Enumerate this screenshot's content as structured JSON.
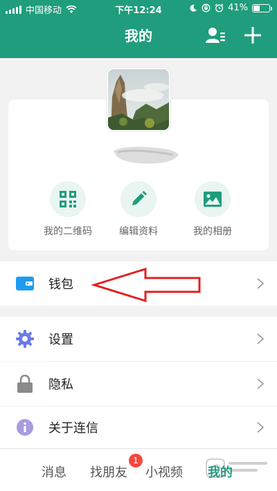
{
  "status_bar": {
    "carrier": "中国移动",
    "time": "下午12:24",
    "battery": "41%",
    "battery_level": 0.41
  },
  "header": {
    "title": "我的",
    "contacts_icon": "person-list-icon",
    "add_icon": "plus-icon"
  },
  "profile": {
    "quick_actions": [
      {
        "label": "我的二维码",
        "icon": "qr-code-icon"
      },
      {
        "label": "编辑资料",
        "icon": "pencil-icon"
      },
      {
        "label": "我的相册",
        "icon": "photo-icon"
      }
    ]
  },
  "menu": {
    "wallet": {
      "label": "钱包",
      "icon": "wallet-icon"
    },
    "settings": {
      "label": "设置",
      "icon": "gear-icon"
    },
    "privacy": {
      "label": "隐私",
      "icon": "lock-icon"
    },
    "about": {
      "label": "关于连信",
      "icon": "info-icon"
    }
  },
  "tabs": {
    "messages": "消息",
    "friends": "找朋友",
    "friends_badge": "1",
    "videos": "小视频",
    "me": "我的"
  },
  "colors": {
    "brand": "#1f9d7c",
    "badge": "#f04a3f",
    "annotation": "#e02020"
  }
}
